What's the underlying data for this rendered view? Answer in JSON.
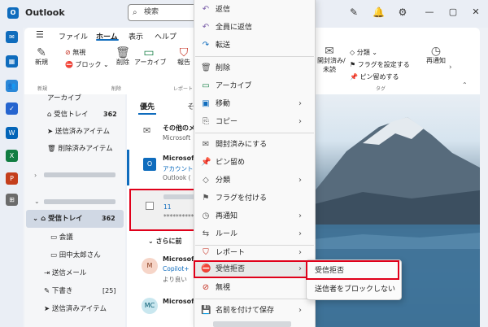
{
  "app": {
    "title": "Outlook",
    "logo": "O"
  },
  "search": {
    "placeholder": "検索"
  },
  "ribbon": {
    "tabs": [
      "ファイル",
      "ホーム",
      "表示",
      "ヘルプ"
    ],
    "buttons": {
      "new": "新規",
      "ignore": "無視",
      "block": "ブロック",
      "delete": "削除",
      "archive": "アーカイブ",
      "report": "報告",
      "mark_read": "開封済み/",
      "mark_read2": "未読",
      "categorize": "分類",
      "flag": "フラグを設定する",
      "pin": "ピン留めする",
      "snooze": "再通知"
    },
    "groups": {
      "new": "新規",
      "delete": "削除",
      "report": "レポート",
      "tags": "タグ"
    }
  },
  "nav": {
    "items": [
      {
        "label": "アーカイブ",
        "count": ""
      },
      {
        "label": "受信トレイ",
        "count": "362"
      },
      {
        "label": "送信済みアイテム",
        "count": ""
      },
      {
        "label": "削除済みアイテム",
        "count": ""
      },
      {
        "label": "受信トレイ",
        "count": "362"
      },
      {
        "label": "会議",
        "count": ""
      },
      {
        "label": "田中太郎さん",
        "count": ""
      },
      {
        "label": "送信メール",
        "count": ""
      },
      {
        "label": "下書き",
        "count": "[25]"
      },
      {
        "label": "送信済みアイテム",
        "count": ""
      }
    ]
  },
  "mail_list": {
    "tab_focused": "優先",
    "tab_other": "そ",
    "group_earlier": "さらに前",
    "rows": [
      {
        "sender": "その他のメー",
        "preview": "Microsoft"
      },
      {
        "sender": "Microsoft",
        "subject": "アカウントを",
        "preview": "Outlook ("
      },
      {
        "sender": "",
        "subject": "11",
        "preview": "**********"
      },
      {
        "sender": "Microsoft",
        "subject": "Copilot+",
        "preview": "より良い",
        "avatar": "M"
      },
      {
        "sender": "Microsoft",
        "preview": "",
        "avatar": "MC"
      }
    ]
  },
  "context_menu": {
    "items": [
      {
        "icon": "↶",
        "label": "返信",
        "arrow": ""
      },
      {
        "icon": "↶",
        "label": "全員に返信",
        "arrow": ""
      },
      {
        "icon": "↷",
        "label": "転送",
        "arrow": ""
      },
      {
        "icon": "🗑",
        "label": "削除",
        "arrow": ""
      },
      {
        "icon": "▭",
        "label": "アーカイブ",
        "arrow": ""
      },
      {
        "icon": "▣",
        "label": "移動",
        "arrow": "›"
      },
      {
        "icon": "⎘",
        "label": "コピー",
        "arrow": "›"
      },
      {
        "icon": "✉",
        "label": "開封済みにする",
        "arrow": ""
      },
      {
        "icon": "📌",
        "label": "ピン留め",
        "arrow": ""
      },
      {
        "icon": "◇",
        "label": "分類",
        "arrow": "›"
      },
      {
        "icon": "⚑",
        "label": "フラグを付ける",
        "arrow": ""
      },
      {
        "icon": "◷",
        "label": "再通知",
        "arrow": "›"
      },
      {
        "icon": "⇆",
        "label": "ルール",
        "arrow": "›"
      },
      {
        "icon": "⛉",
        "label": "レポート",
        "arrow": "›"
      },
      {
        "icon": "⛔",
        "label": "受信拒否",
        "arrow": "›"
      },
      {
        "icon": "⊘",
        "label": "無視",
        "arrow": ""
      },
      {
        "icon": "💾",
        "label": "名前を付けて保存",
        "arrow": "›"
      }
    ]
  },
  "submenu": {
    "items": [
      "受信拒否",
      "送信者をブロックしない"
    ]
  }
}
